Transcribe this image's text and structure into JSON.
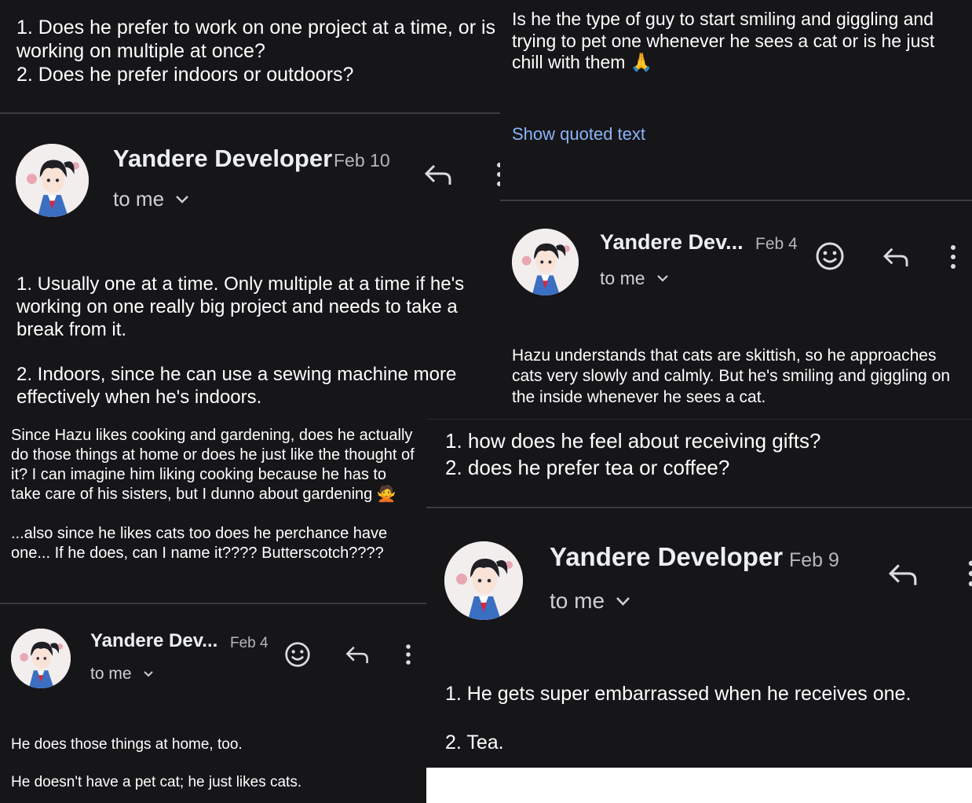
{
  "panel_top_left": {
    "question": [
      "1. Does he prefer to work on one project at a time, or is working on multiple at once?",
      "2. Does he prefer indoors or outdoors?"
    ],
    "sender": "Yandere Developer",
    "date": "Feb 10",
    "recipient": "to me",
    "reply": [
      "1. Usually one at a time. Only multiple at a time if he's working on one really big project and needs to take a break from it.",
      "2. Indoors, since he can use a sewing machine more effectively when he's indoors."
    ]
  },
  "panel_top_right": {
    "question": "Is he the type of guy to start smiling and giggling and trying to pet one whenever he sees a cat or is he just chill with them",
    "question_emoji": "🙏",
    "show_quoted": "Show quoted text",
    "sender": "Yandere Dev...",
    "date": "Feb 4",
    "recipient": "to me",
    "reply": "Hazu understands that cats are skittish, so he approaches cats very slowly and calmly. But he's smiling and giggling on the inside whenever he sees a cat."
  },
  "panel_bottom_left": {
    "question_1": "Since Hazu likes cooking and gardening, does he actually do those things at home or does he just like the thought of it? I can imagine him liking cooking because he has to take care of his sisters, but I dunno about gardening",
    "question_1_emoji": "🙅",
    "question_2": "...also since he likes cats too does he perchance have one... If he does, can I name it???? Butterscotch????",
    "sender": "Yandere Dev...",
    "date": "Feb 4",
    "recipient": "to me",
    "reply": [
      "He does those things at home, too.",
      "He doesn't have a pet cat; he just likes cats."
    ]
  },
  "panel_bottom_right": {
    "question": [
      "1. how does he feel about receiving gifts?",
      "2. does he prefer tea or coffee?"
    ],
    "sender": "Yandere Developer",
    "date": "Feb 9",
    "recipient": "to me",
    "reply": [
      "1. He gets super embarrassed when he receives one.",
      "2. Tea."
    ]
  },
  "icons": {
    "reply": "reply-arrow-icon",
    "more": "vertical-dots-icon",
    "emoji": "smiley-face-icon",
    "chevron": "chevron-down-icon",
    "avatar": "anime-girl-avatar"
  },
  "colors": {
    "background": "#161518",
    "link": "#8ab4f8",
    "divider": "#3c3b40"
  }
}
